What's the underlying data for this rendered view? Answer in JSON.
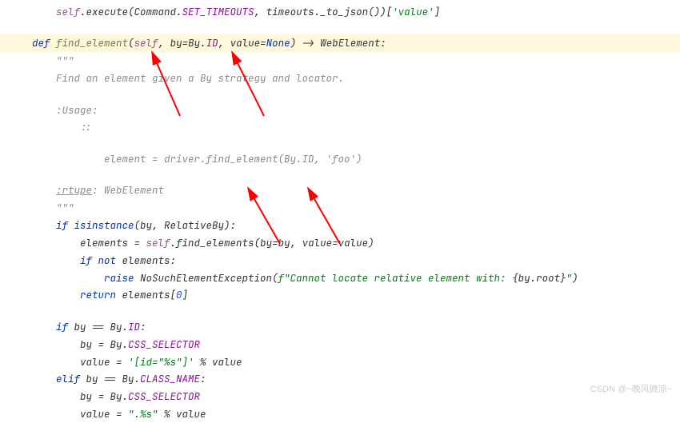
{
  "code": {
    "l1_a": "self",
    "l1_b": ".execute(Command.",
    "l1_c": "SET_TIMEOUTS",
    "l1_d": ", timeouts._to_json())[",
    "l1_e": "'value'",
    "l1_f": "]",
    "l2_a": "def ",
    "l2_b": "find_element",
    "l2_c": "(",
    "l2_d": "self",
    "l2_e": ", ",
    "l2_f": "by",
    "l2_g": "=By.",
    "l2_h": "ID",
    "l2_i": ", ",
    "l2_j": "value",
    "l2_k": "=",
    "l2_l": "None",
    "l2_m": ") -> WebElement:",
    "l3": "\"\"\"",
    "l4": "Find an element given a By strategy and locator.",
    "l5": ":Usage:",
    "l6": "::",
    "l7": "element = driver.find_element(By.ID, 'foo')",
    "l8_a": ":rtype",
    "l8_b": ": WebElement",
    "l9": "\"\"\"",
    "l10_a": "if ",
    "l10_b": "isinstance",
    "l10_c": "(by, RelativeBy):",
    "l11_a": "elements = ",
    "l11_b": "self",
    "l11_c": ".find_elements(",
    "l11_d": "by",
    "l11_e": "=by, ",
    "l11_f": "value",
    "l11_g": "=value)",
    "l12_a": "if not ",
    "l12_b": "elements:",
    "l13_a": "raise ",
    "l13_b": "NoSuchElementException(",
    "l13_c": "f\"Cannot locate relative element with: ",
    "l13_d": "{by.root}",
    "l13_e": "\"",
    "l13_f": ")",
    "l14_a": "return ",
    "l14_b": "elements[",
    "l14_c": "0",
    "l14_d": "]",
    "l15_a": "if ",
    "l15_b": "by == By.",
    "l15_c": "ID",
    "l15_d": ":",
    "l16_a": "by = By.",
    "l16_b": "CSS_SELECTOR",
    "l17_a": "value = ",
    "l17_b": "'[id=\"%s\"]'",
    "l17_c": " % value",
    "l18_a": "elif ",
    "l18_b": "by == By.",
    "l18_c": "CLASS_NAME",
    "l18_d": ":",
    "l19_a": "by = By.",
    "l19_b": "CSS_SELECTOR",
    "l20_a": "value = ",
    "l20_b": "\".%s\"",
    "l20_c": " % value"
  },
  "watermark": "CSDN @~晚风微凉~"
}
